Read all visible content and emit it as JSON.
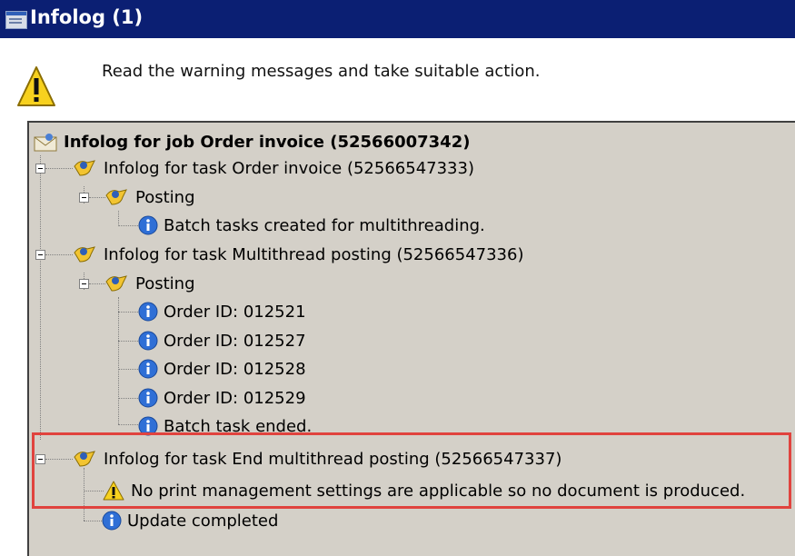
{
  "window": {
    "title": "Infolog (1)"
  },
  "header": {
    "message": "Read the warning messages and take suitable action."
  },
  "tree": {
    "root": "Infolog for job Order invoice (52566007342)",
    "task1": "Infolog for task Order invoice (52566547333)",
    "task1_posting": "Posting",
    "task1_msg": "Batch tasks created for multithreading.",
    "task2": "Infolog for task Multithread posting (52566547336)",
    "task2_posting": "Posting",
    "orders": [
      "Order ID: 012521",
      "Order ID: 012527",
      "Order ID: 012528",
      "Order ID: 012529"
    ],
    "batch_ended": "Batch task ended.",
    "task3": "Infolog for task End multithread posting (52566547337)",
    "warning": "No print management settings are applicable so no document is produced.",
    "update": "Update completed"
  },
  "colors": {
    "titlebar": "#0b1f73",
    "panel": "#d4d0c8",
    "highlight": "#e0433e"
  }
}
